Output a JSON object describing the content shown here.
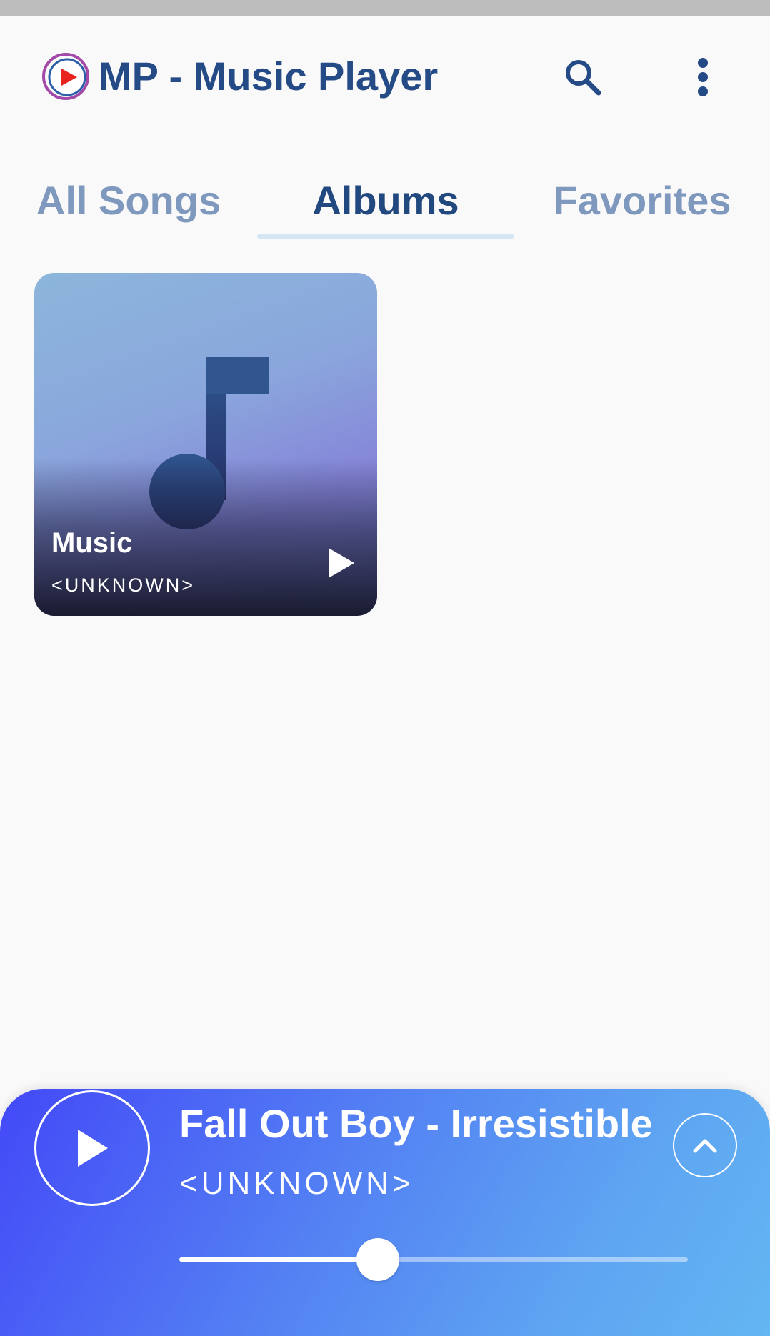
{
  "app": {
    "title": "MP - Music Player",
    "colors": {
      "title": "#254b86",
      "tab_inactive": "#7f98bd",
      "tab_active": "#22497f"
    }
  },
  "toolbar": {
    "search_icon": "search-icon",
    "more_icon": "more-vert-icon"
  },
  "tabs": [
    {
      "label": "All Songs",
      "active": false
    },
    {
      "label": "Albums",
      "active": true
    },
    {
      "label": "Favorites",
      "active": false
    }
  ],
  "albums": [
    {
      "title": "Music",
      "artist": "<UNKNOWN>",
      "art_icon": "music-note-icon",
      "action_icon": "play-icon"
    }
  ],
  "mini_player": {
    "title": "Fall Out Boy - Irresistible",
    "artist": "<UNKNOWN>",
    "progress": 0.39,
    "play_icon": "play-icon",
    "expand_icon": "chevron-up-icon"
  }
}
